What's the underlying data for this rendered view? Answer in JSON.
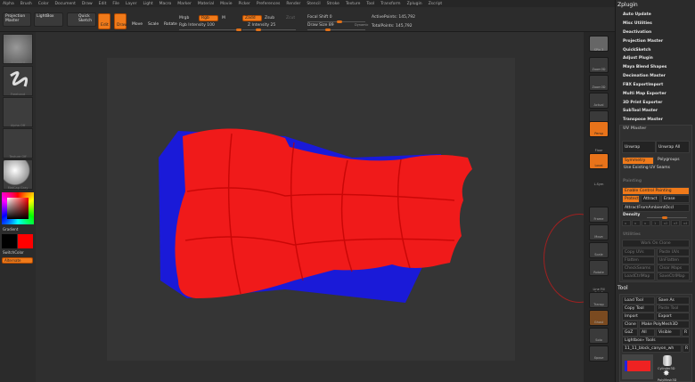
{
  "menu": [
    "Alpha",
    "Brush",
    "Color",
    "Document",
    "Draw",
    "Edit",
    "File",
    "Layer",
    "Light",
    "Macro",
    "Marker",
    "Material",
    "Movie",
    "Picker",
    "Preferences",
    "Render",
    "Stencil",
    "Stroke",
    "Texture",
    "Tool",
    "Transform",
    "Zplugin",
    "Zscript"
  ],
  "toolbar": {
    "projection_master": "Projection Master",
    "lightbox": "LightBox",
    "quick_sketch": "Quick Sketch",
    "edit": "Edit",
    "draw": "Draw",
    "move": "Move",
    "scale": "Scale",
    "rotate": "Rotate",
    "mrgb": "Mrgb",
    "rgb": "Rgb",
    "m": "M",
    "zadd": "Zadd",
    "zsub": "Zsub",
    "zcut": "Zcut",
    "rgb_intensity": "Rgb Intensity 100",
    "z_intensity": "Z Intensity 25",
    "focal_shift": "Focal Shift 0",
    "draw_size": "Draw Size 89",
    "dynamic": "Dynamic",
    "active_points": "ActivePoints: 145,792",
    "total_points": "TotalPoints: 145,792",
    "rgb_intensity_value": 100,
    "z_intensity_value": 25,
    "focal_shift_value": 0,
    "draw_size_value": 89
  },
  "left": {
    "brush": "Standard",
    "stroke": "Freehand",
    "alpha": "Alpha Off",
    "texture": "Texture Off",
    "material": "MatCap Gray",
    "gradient": "Gradient",
    "switch_color": "SwitchColor",
    "alternate": "Alternate",
    "main_color": "#ff0000",
    "secondary_color": "#000000"
  },
  "shelf": [
    "SPix 3",
    "Persp",
    "Floor",
    "Local",
    "L.Sym",
    "Frame",
    "Move",
    "Scale",
    "Rotate",
    "Line Fill PolyF",
    "Transp",
    "Ghost",
    "Solo",
    "Xpose",
    "Zoom3D",
    "Actual",
    "AAHalf"
  ],
  "zplugin": {
    "title": "Zplugin",
    "items": [
      "Auto Update",
      "Misc Utilities",
      "Deactivation",
      "Projection Master",
      "QuickSketch",
      "Adjust Plugin",
      "Maya Blend Shapes",
      "Decimation Master",
      "FBX ExportImport",
      "Multi Map Exporter",
      "3D Print Exporter",
      "SubTool Master",
      "Transpose Master"
    ],
    "uv_master": {
      "title": "UV Master",
      "unwrap": "Unwrap",
      "unwrap_all": "Unwrap All",
      "symmetry": "Symmetry",
      "polygroups": "Polygroups",
      "use_existing": "Use Existing UV Seams",
      "painting": "Painting",
      "enable_cp": "Enable Control Painting",
      "protect": "Protect",
      "attract": "Attract",
      "erase": "Erase",
      "ambient": "AttractFromAmbientOccl",
      "density": "Density",
      "density_value": "Density",
      "density_steps": [
        "x",
        "x",
        "x",
        "1",
        "x2",
        "x3",
        "x4"
      ],
      "utilities": "Utilities",
      "work_on_clone": "Work On Clone",
      "copy_uvs": "Copy UVs",
      "paste_uvs": "Paste UVs",
      "flatten": "Flatten",
      "unflatten": "UnFlatten",
      "check_seams": "CheckSeams",
      "clear_maps": "Clear Maps",
      "load_ctrl": "LoadCtrlMap",
      "save_ctrl": "SaveCtrlMap"
    }
  },
  "tool": {
    "title": "Tool",
    "load_tool": "Load Tool",
    "save_as": "Save As",
    "copy_tool": "Copy Tool",
    "paste_tool": "Paste Tool",
    "import": "Import",
    "export": "Export",
    "clone": "Clone",
    "make_polymesh": "Make PolyMesh3D",
    "goz": "GoZ",
    "all": "All",
    "visible": "Visible",
    "r": "R",
    "lightbox_tools": "Lightbox» Tools",
    "current_tool": "11_11_block_canyon_wh",
    "r2": "R",
    "thumbs": [
      "Cylinder3D",
      "PolyMesh3D"
    ]
  }
}
